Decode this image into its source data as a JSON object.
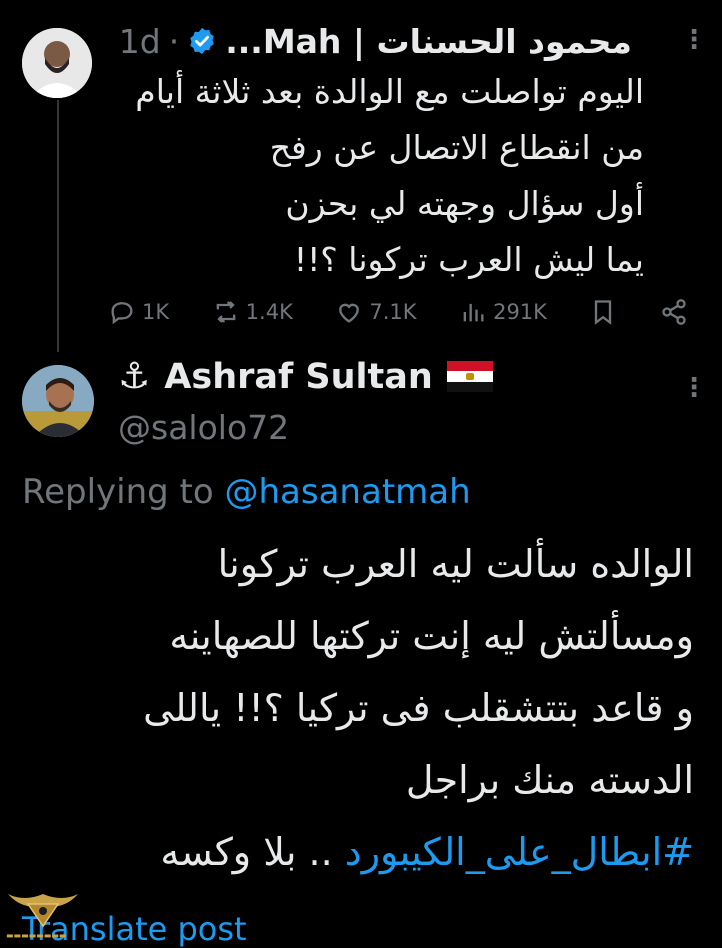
{
  "tweet1": {
    "author_name": "محمود الحسنات | Mah...",
    "separator": "·",
    "time": "1d",
    "lines": [
      "اليوم تواصلت مع الوالدة بعد ثلاثة أيام",
      "من انقطاع الاتصال عن رفح",
      "أول سؤال وجهته لي بحزن",
      "يما ليش العرب تركونا ؟!!"
    ],
    "actions": {
      "replies": "1K",
      "reposts": "1.4K",
      "likes": "7.1K",
      "views": "291K"
    }
  },
  "tweet2": {
    "anchor": "⚓",
    "author_name": "Ashraf Sultan",
    "handle": "@salolo72",
    "replying_prefix": "Replying to ",
    "replying_to": "@hasanatmah",
    "lines": [
      "الوالده سألت ليه العرب تركونا",
      "ومسألتش ليه إنت تركتها  للصهاينه",
      "و قاعد بتتشقلب فى تركيا ؟!! ياللى",
      "الدسته منك براجل"
    ],
    "hashtag": "#ابطال_على_الكيبورد",
    "last_line_suffix": " .. بلا وكسه",
    "translate": "Translate post"
  },
  "colors": {
    "background": "#000000",
    "text": "#e7e9ea",
    "muted": "#71767b",
    "link": "#1d9bf0",
    "verified": "#1d9bf0"
  },
  "icons": [
    "more-icon",
    "verified-badge-icon",
    "reply-icon",
    "repost-icon",
    "like-icon",
    "views-icon",
    "bookmark-icon",
    "share-icon",
    "egypt-flag-icon",
    "watermark-logo"
  ]
}
